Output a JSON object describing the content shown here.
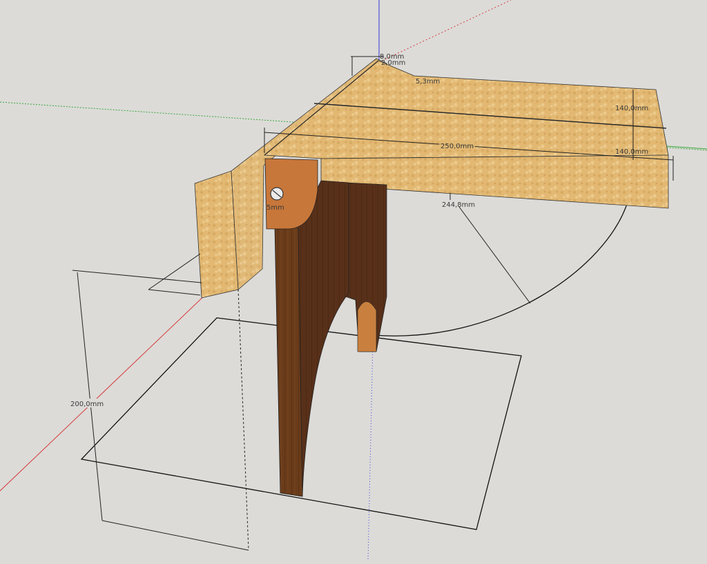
{
  "scene": {
    "colors": {
      "background": "#dcdbd8",
      "axis_red": "#d63a3a",
      "axis_green": "#3aa63a",
      "axis_blue": "#3a3ad6",
      "plywood": "#e0b66e",
      "plywood_light": "#eccb8c",
      "walnut": "#6b3c1a",
      "walnut_dark": "#4a2810",
      "cleat": "#c8773a"
    },
    "dimensions": {
      "d1": "8,0mm",
      "d2": "2,0mm",
      "d3": "5,3mm",
      "d4": "140,0mm",
      "d5": "250,0mm",
      "d6": "140,0mm",
      "d7": "244,8mm",
      "d8": "5mm",
      "d9": "200,0mm"
    }
  }
}
